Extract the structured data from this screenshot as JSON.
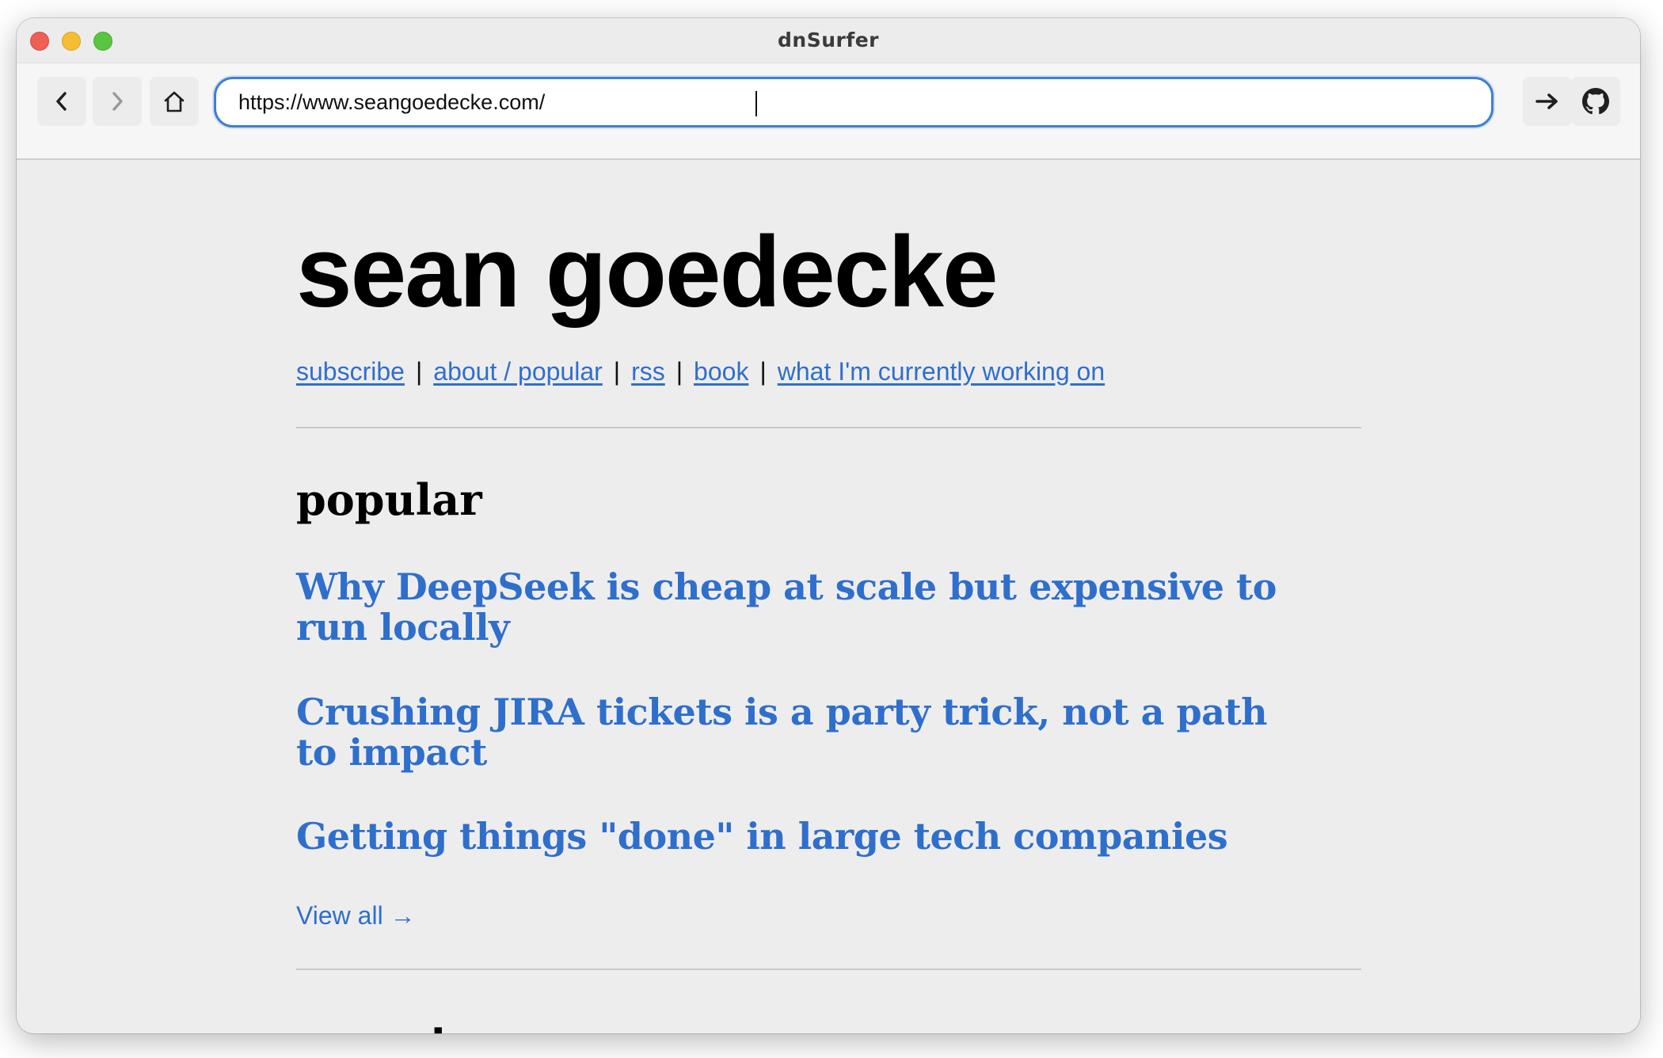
{
  "window": {
    "title": "dnSurfer"
  },
  "toolbar": {
    "back_icon": "chevron-left-icon",
    "forward_icon": "chevron-right-icon",
    "home_icon": "home-icon",
    "go_icon": "arrow-right-icon",
    "github_icon": "github-icon",
    "url": "https://www.seangoedecke.com/"
  },
  "page": {
    "site_title": "sean goedecke",
    "nav": [
      {
        "label": "subscribe"
      },
      {
        "label": "about / popular"
      },
      {
        "label": "rss"
      },
      {
        "label": "book"
      },
      {
        "label": "what I'm currently working on"
      }
    ],
    "nav_separator": "|",
    "popular_heading": "popular",
    "popular_posts": [
      {
        "title": "Why DeepSeek is cheap at scale but expensive to run locally"
      },
      {
        "title": "Crushing JIRA tickets is a party trick, not a path to impact"
      },
      {
        "title": "Getting things \"done\" in large tech companies"
      }
    ],
    "view_all": "View all →",
    "recent_heading": "recent"
  },
  "colors": {
    "link": "#2f6fcc",
    "url_focus": "#3d7fd6",
    "page_background": "#eeedee"
  }
}
